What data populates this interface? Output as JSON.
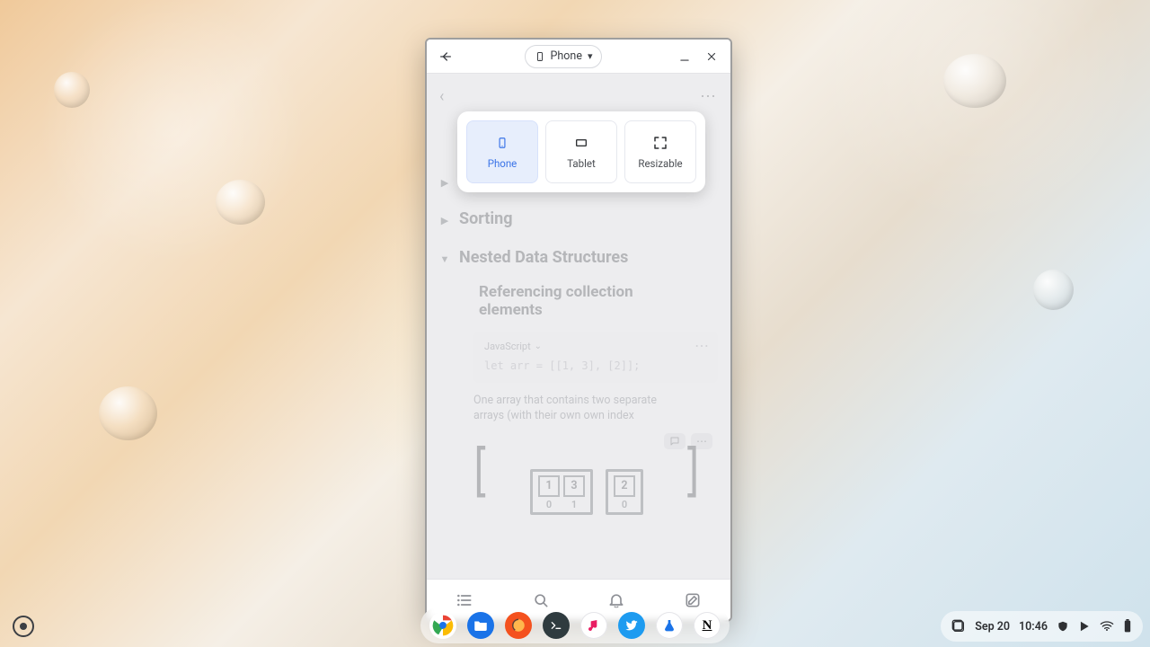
{
  "window": {
    "device_chip_label": "Phone",
    "page_title_hidden": "",
    "minimize_aria": "Minimize",
    "close_aria": "Close"
  },
  "popover": {
    "options": [
      {
        "id": "phone",
        "label": "Phone",
        "selected": true
      },
      {
        "id": "tablet",
        "label": "Tablet",
        "selected": false
      },
      {
        "id": "resizable",
        "label": "Resizable",
        "selected": false
      }
    ]
  },
  "page": {
    "more_label": "⋯",
    "sections": [
      {
        "id": "hidden-first",
        "title": "",
        "collapsed": true,
        "hidden_under_overlay": true
      },
      {
        "id": "sorting",
        "title": "Sorting",
        "collapsed": true
      },
      {
        "id": "nested",
        "title": "Nested Data Structures",
        "collapsed": false
      }
    ],
    "subsection": {
      "title": "Referencing collection elements"
    },
    "code": {
      "language_label": "JavaScript",
      "source": "let arr = [[1, 3], [2]];",
      "more_label": "⋯"
    },
    "caption": "One array that contains two separate arrays (with their own own index",
    "diagram": {
      "outer_open": "[",
      "outer_close": "]",
      "groups": [
        {
          "cells": [
            "1",
            "3"
          ],
          "indices": [
            "0",
            "1"
          ]
        },
        {
          "cells": [
            "2"
          ],
          "indices": [
            "0"
          ]
        }
      ],
      "action_icons": [
        "comment-icon",
        "more-icon"
      ]
    }
  },
  "tabbar": {
    "items": [
      "list-icon",
      "search-icon",
      "bell-icon",
      "compose-icon"
    ]
  },
  "shelf": {
    "dock": [
      {
        "id": "chrome",
        "name": "Chrome",
        "bg": "#ffffff"
      },
      {
        "id": "files",
        "name": "Files",
        "bg": "#1a73e8"
      },
      {
        "id": "fox-app",
        "name": "App",
        "bg": "#f4511e"
      },
      {
        "id": "terminal",
        "name": "Terminal",
        "bg": "#2f3b3f"
      },
      {
        "id": "music",
        "name": "Music",
        "bg": "#ffffff"
      },
      {
        "id": "twitter",
        "name": "Twitter",
        "bg": "#1d9bf0"
      },
      {
        "id": "drive",
        "name": "Drive-like",
        "bg": "#ffffff"
      },
      {
        "id": "notion",
        "name": "Notion",
        "bg": "#ffffff"
      }
    ],
    "tray": {
      "date": "Sep 20",
      "time": "10:46"
    }
  }
}
